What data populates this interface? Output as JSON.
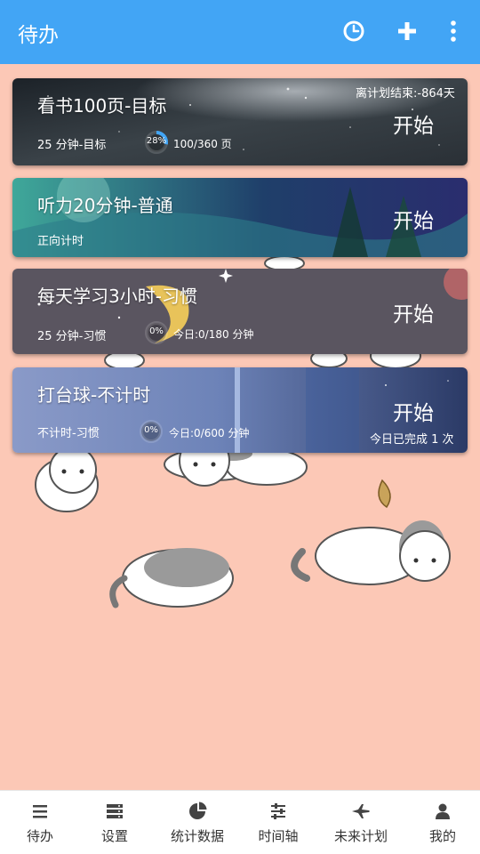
{
  "appbar": {
    "title": "待办",
    "icons": [
      "clock-icon",
      "plus-icon",
      "more-vert-icon"
    ]
  },
  "tasks": [
    {
      "title": "看书100页-目标",
      "subtitle": "25 分钟-目标",
      "progress_percent_label": "28%",
      "progress_fraction": 0.28,
      "progress_text": "100/360 页",
      "extra": "离计划结束:-864天",
      "start_label": "开始"
    },
    {
      "title": "听力20分钟-普通",
      "subtitle": "正向计时",
      "start_label": "开始"
    },
    {
      "title": "每天学习3小时-习惯",
      "subtitle": "25 分钟-习惯",
      "progress_percent_label": "0%",
      "progress_fraction": 0,
      "progress_text": "今日:0/180 分钟",
      "start_label": "开始"
    },
    {
      "title": "打台球-不计时",
      "subtitle": "不计时-习惯",
      "progress_percent_label": "0%",
      "progress_fraction": 0,
      "progress_text": "今日:0/600 分钟",
      "extra": "今日已完成 1 次",
      "start_label": "开始"
    }
  ],
  "bottom_nav": [
    {
      "label": "待办",
      "icon": "list-icon"
    },
    {
      "label": "设置",
      "icon": "settings-stack-icon"
    },
    {
      "label": "统计数据",
      "icon": "pie-chart-icon"
    },
    {
      "label": "时间轴",
      "icon": "sliders-icon"
    },
    {
      "label": "未来计划",
      "icon": "plane-icon"
    },
    {
      "label": "我的",
      "icon": "person-icon"
    }
  ],
  "colors": {
    "appbar": "#42a5f5",
    "background": "#fcc8b6",
    "progress_ring": "#42a5f5"
  }
}
